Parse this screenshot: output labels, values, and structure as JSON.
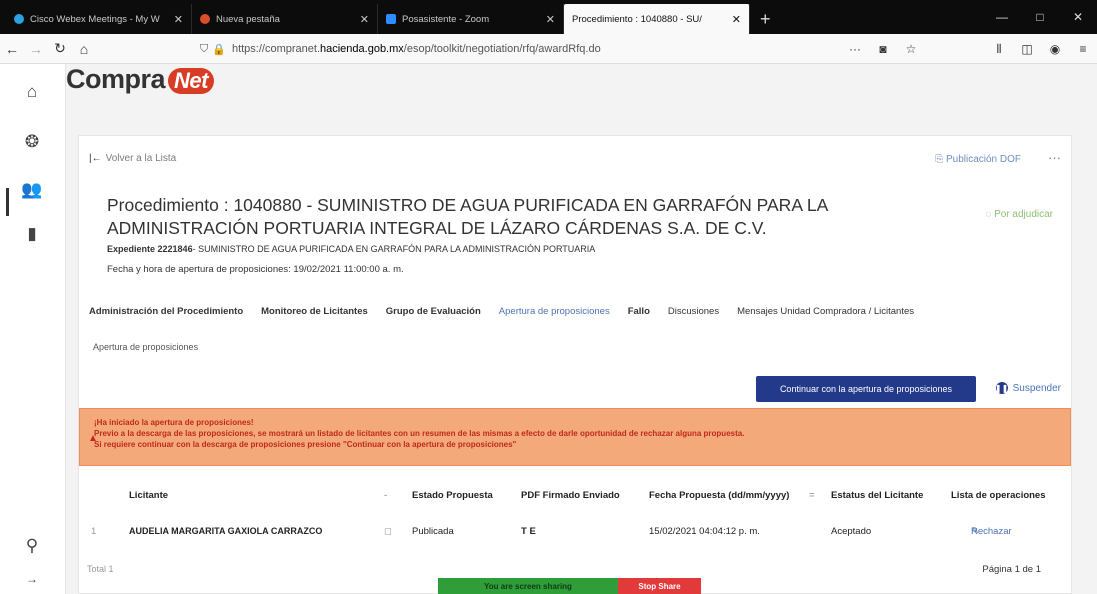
{
  "browser": {
    "tabs": [
      {
        "title": "Cisco Webex Meetings - My W",
        "icon_color": "#2aa3e0",
        "active": false
      },
      {
        "title": "Nueva pestaña",
        "icon_color": "#d94e2b",
        "active": false
      },
      {
        "title": "Posasistente - Zoom",
        "icon_color": "#2d8cff",
        "active": false
      },
      {
        "title": "Procedimiento : 1040880 - SU/",
        "icon_color": "#ffffff",
        "active": true
      }
    ],
    "new_tab": "+",
    "url_prefix": "https://compranet.",
    "url_host": "hacienda.gob.mx",
    "url_path": "/esop/toolkit/negotiation/rfq/awardRfq.do",
    "url_dots": "···"
  },
  "logo": {
    "left": "Compra",
    "right": "Net"
  },
  "panel": {
    "back_label": "Volver a la Lista",
    "publication_label": "Publicación DOF",
    "more": "···",
    "title": "Procedimiento : 1040880 - SUMINISTRO DE AGUA PURIFICADA EN GARRAFÓN PARA LA ADMINISTRACIÓN PORTUARIA INTEGRAL DE LÁZARO CÁRDENAS S.A. DE C.V.",
    "status": "Por adjudicar",
    "expediente_label": "Expediente",
    "expediente_num": "2221846",
    "expediente_desc": "- SUMINISTRO DE AGUA PURIFICADA EN GARRAFÓN PARA LA ADMINISTRACIÓN PORTUARIA",
    "fecha": "Fecha y hora de apertura de proposiciones: 19/02/2021 11:00:00 a. m.",
    "tabs": [
      "Administración del Procedimiento",
      "Monitoreo de Licitantes",
      "Grupo de Evaluación",
      "Apertura de proposiciones",
      "Fallo",
      "Discusiones",
      "Mensajes Unidad Compradora / Licitantes"
    ],
    "section_label": "Apertura de proposiciones",
    "continue_button": "Continuar con la apertura de proposiciones",
    "suspend_button": "Suspender",
    "alert_lines": [
      "¡Ha iniciado la apertura de proposiciones!",
      "Previo a la descarga de las proposiciones, se mostrará un listado de licitantes con un resumen de las mismas a efecto de darle oportunidad de rechazar alguna propuesta.",
      "Si requiere continuar con la descarga de proposiciones presione \"Continuar con la apertura de proposiciones\""
    ],
    "table": {
      "headers": [
        "Licitante",
        "Estado Propuesta",
        "PDF Firmado Enviado",
        "Fecha Propuesta (dd/mm/yyyy)",
        "Estatus del Licitante",
        "Lista de operaciones"
      ],
      "rows": [
        {
          "index": "1",
          "licitante": "AUDELIA MARGARITA GAXIOLA CARRAZCO",
          "estado": "Publicada",
          "pdf": "T E",
          "fecha": "15/02/2021 04:04:12 p. m.",
          "estatus": "Aceptado",
          "operacion": "Rechazar"
        }
      ]
    },
    "total": "Total 1",
    "pager": "Página 1 de 1"
  },
  "share_bar": {
    "sharing_label": "You are screen sharing",
    "stop_label": "Stop Share"
  },
  "colors": {
    "accent": "#23398a",
    "alert_bg": "#f4a97a",
    "alert_text": "#c0291b",
    "link": "#4b74b5"
  }
}
